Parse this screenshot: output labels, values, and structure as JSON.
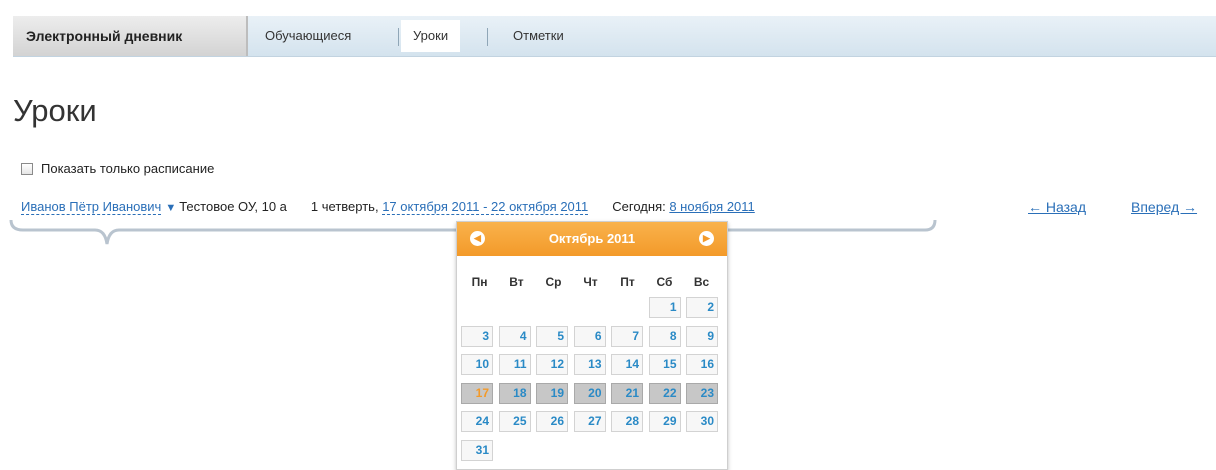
{
  "nav": {
    "brand": "Электронный дневник",
    "tabs": [
      {
        "label": "Обучающиеся"
      },
      {
        "label": "Уроки"
      },
      {
        "label": "Отметки"
      }
    ]
  },
  "page": {
    "title": "Уроки"
  },
  "filters": {
    "show_schedule_only": "Показать только расписание",
    "show_schedule_checked": false
  },
  "context": {
    "student": "Иванов Пётр Иванович",
    "school": "Тестовое ОУ, 10 а",
    "quarter": "1 четверть,",
    "period": "17 октября 2011 - 22 октября 2011",
    "today_label": "Сегодня:",
    "today": "8 ноября 2011"
  },
  "pager": {
    "back": "← Назад",
    "forward": "Вперед →"
  },
  "calendar": {
    "month_label": "Октябрь 2011",
    "weekdays": [
      "Пн",
      "Вт",
      "Ср",
      "Чт",
      "Пт",
      "Сб",
      "Вс"
    ],
    "weeks": [
      [
        "",
        "",
        "",
        "",
        "",
        "1",
        "2"
      ],
      [
        "3",
        "4",
        "5",
        "6",
        "7",
        "8",
        "9"
      ],
      [
        "10",
        "11",
        "12",
        "13",
        "14",
        "15",
        "16"
      ],
      [
        "17",
        "18",
        "19",
        "20",
        "21",
        "22",
        "23"
      ],
      [
        "24",
        "25",
        "26",
        "27",
        "28",
        "29",
        "30"
      ],
      [
        "31",
        "",
        "",
        "",
        "",
        "",
        ""
      ]
    ],
    "selected_week": [
      "17",
      "18",
      "19",
      "20",
      "21",
      "22",
      "23"
    ],
    "highlight_day": "17",
    "colors": {
      "header": "#f39a2a",
      "day_text": "#2a8ac6",
      "selected_bg": "#c7c7c7"
    }
  }
}
